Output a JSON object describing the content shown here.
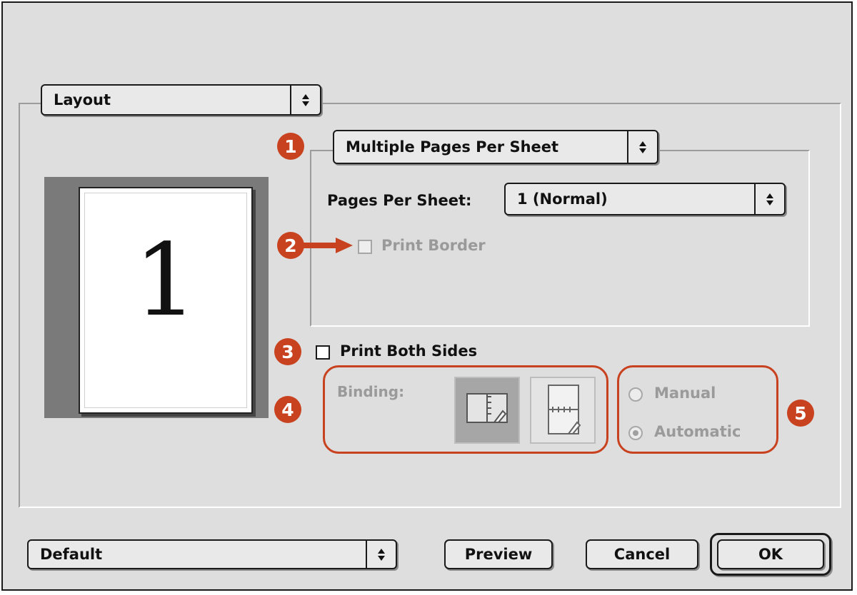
{
  "panel_menu": {
    "label": "Layout"
  },
  "layout_option_menu": {
    "label": "Multiple Pages Per Sheet"
  },
  "pages_per_sheet": {
    "label": "Pages Per Sheet:",
    "value": "1 (Normal)"
  },
  "print_border": {
    "label": "Print Border",
    "checked": false,
    "enabled": false
  },
  "print_both_sides": {
    "label": "Print Both Sides",
    "checked": false
  },
  "binding": {
    "label": "Binding:",
    "options": [
      "book-binding-icon",
      "tablet-binding-icon"
    ],
    "selected": "book-binding-icon"
  },
  "duplex_mode": {
    "manual_label": "Manual",
    "automatic_label": "Automatic",
    "selected": "Automatic"
  },
  "preview": {
    "page_number": "1"
  },
  "callouts": [
    "1",
    "2",
    "3",
    "4",
    "5"
  ],
  "settings_menu": {
    "label": "Default"
  },
  "buttons": {
    "preview": "Preview",
    "cancel": "Cancel",
    "ok": "OK"
  },
  "colors": {
    "callout": "#c8421f",
    "dialog_bg": "#dedede",
    "preview_bg": "#7a7a7a"
  }
}
